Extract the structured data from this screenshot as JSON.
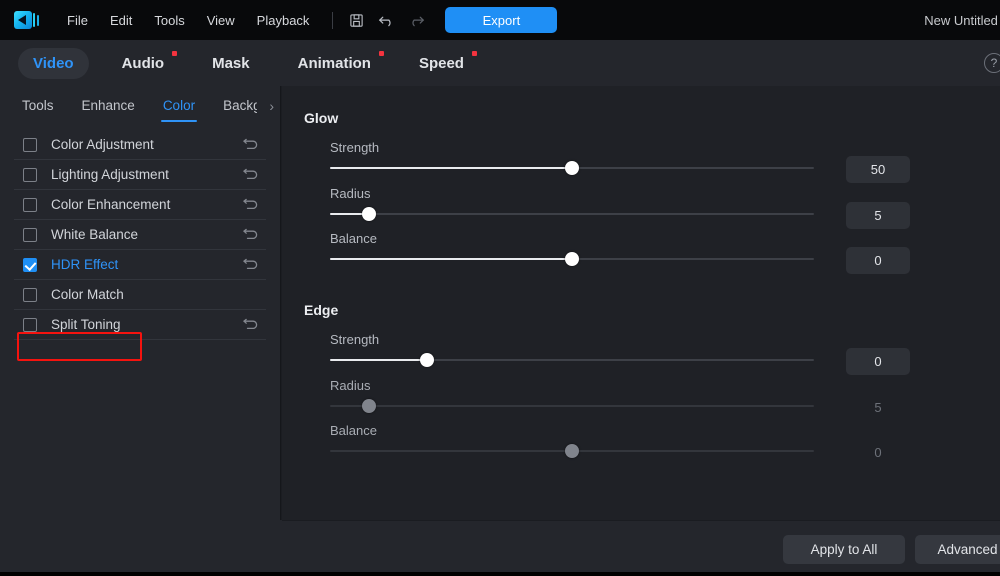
{
  "app": {
    "logo_icon": "video-editor-logo",
    "project_title": "New Untitled Project"
  },
  "menubar": {
    "items": [
      {
        "label": "File"
      },
      {
        "label": "Edit"
      },
      {
        "label": "Tools"
      },
      {
        "label": "View"
      },
      {
        "label": "Playback"
      }
    ],
    "icons": [
      {
        "name": "save-icon",
        "glyph": "save"
      },
      {
        "name": "undo-icon",
        "glyph": "undo"
      },
      {
        "name": "redo-icon",
        "glyph": "redo"
      }
    ],
    "export_label": "Export",
    "accent_color": "#1f8ff5"
  },
  "tabs": [
    {
      "label": "Video",
      "active": true,
      "badge": false
    },
    {
      "label": "Audio",
      "active": false,
      "badge": true
    },
    {
      "label": "Mask",
      "active": false,
      "badge": false
    },
    {
      "label": "Animation",
      "active": false,
      "badge": true
    },
    {
      "label": "Speed",
      "active": false,
      "badge": true
    }
  ],
  "help_icon_label": "?",
  "subtabs": {
    "items": [
      {
        "label": "Tools",
        "active": false
      },
      {
        "label": "Enhance",
        "active": false
      },
      {
        "label": "Color",
        "active": true
      },
      {
        "label": "Backg",
        "active": false
      }
    ],
    "next_arrow": "›"
  },
  "effects": [
    {
      "label": "Color Adjustment",
      "checked": false,
      "reset": true,
      "selected": false
    },
    {
      "label": "Lighting Adjustment",
      "checked": false,
      "reset": true,
      "selected": false
    },
    {
      "label": "Color Enhancement",
      "checked": false,
      "reset": true,
      "selected": false
    },
    {
      "label": "White Balance",
      "checked": false,
      "reset": true,
      "selected": false
    },
    {
      "label": "HDR Effect",
      "checked": true,
      "reset": true,
      "selected": true
    },
    {
      "label": "Color Match",
      "checked": false,
      "reset": false,
      "selected": false
    },
    {
      "label": "Split Toning",
      "checked": false,
      "reset": true,
      "selected": false
    }
  ],
  "highlight_color": "#f5130f",
  "groups": [
    {
      "title": "Glow",
      "sliders": [
        {
          "label": "Strength",
          "value": "50",
          "percent": 50,
          "enabled": true
        },
        {
          "label": "Radius",
          "value": "5",
          "percent": 8,
          "enabled": true
        },
        {
          "label": "Balance",
          "value": "0",
          "percent": 50,
          "enabled": true
        }
      ]
    },
    {
      "title": "Edge",
      "sliders": [
        {
          "label": "Strength",
          "value": "0",
          "percent": 20,
          "enabled": true
        },
        {
          "label": "Radius",
          "value": "5",
          "percent": 8,
          "enabled": false
        },
        {
          "label": "Balance",
          "value": "0",
          "percent": 50,
          "enabled": false
        }
      ]
    }
  ],
  "footer": {
    "apply_all_label": "Apply to All",
    "advanced_label": "Advanced"
  }
}
